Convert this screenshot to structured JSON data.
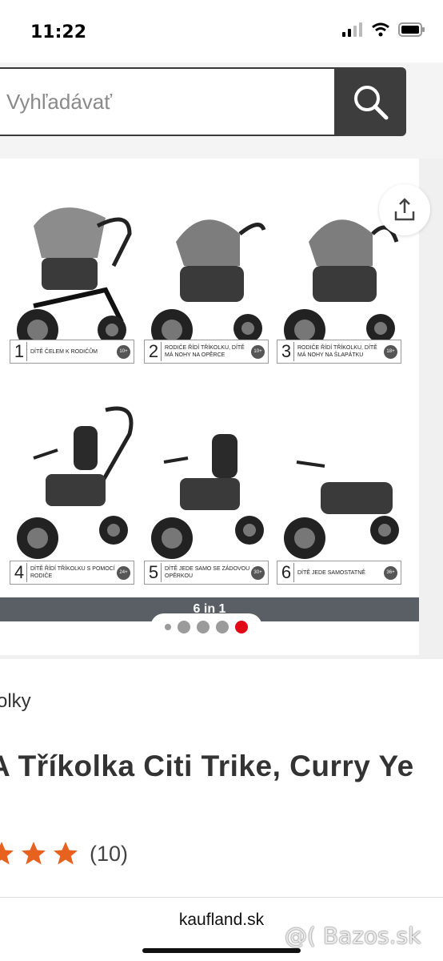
{
  "status": {
    "time": "11:22"
  },
  "search": {
    "placeholder": "Vyhľadávať"
  },
  "gallery": {
    "panels": [
      {
        "num": "1",
        "text": "DÍTĚ ČELEM K RODIČŮM",
        "age": "10+"
      },
      {
        "num": "2",
        "text": "RODIČE ŘÍDÍ TŘÍKOLKU, DÍTĚ MÁ NOHY NA OPĚRCE",
        "age": "10+"
      },
      {
        "num": "3",
        "text": "RODIČE ŘÍDÍ TŘÍKOLKU, DÍTĚ MÁ NOHY NA ŠLAPÁTKU",
        "age": "18+"
      },
      {
        "num": "4",
        "text": "DÍTĚ ŘÍDÍ TŘÍKOLKU S POMOCÍ RODIČE",
        "age": "24+"
      },
      {
        "num": "5",
        "text": "DÍTĚ JEDE SAMO SE ZÁDOVOU OPĚRKOU",
        "age": "30+"
      },
      {
        "num": "6",
        "text": "DÍTĚ JEDE SAMOSTATNĚ",
        "age": "36+"
      }
    ],
    "banner": "6 in 1",
    "active_slide": 5
  },
  "product": {
    "category": "olky",
    "title": "A Tříkolka Citi Trike, Curry Ye",
    "rating_count": "(10)"
  },
  "footer": {
    "domain": "kaufland.sk"
  },
  "watermark": "@( Bazos.sk",
  "colors": {
    "accent_red": "#e10915",
    "star_orange": "#e8621f",
    "search_button": "#3d3d3d"
  }
}
